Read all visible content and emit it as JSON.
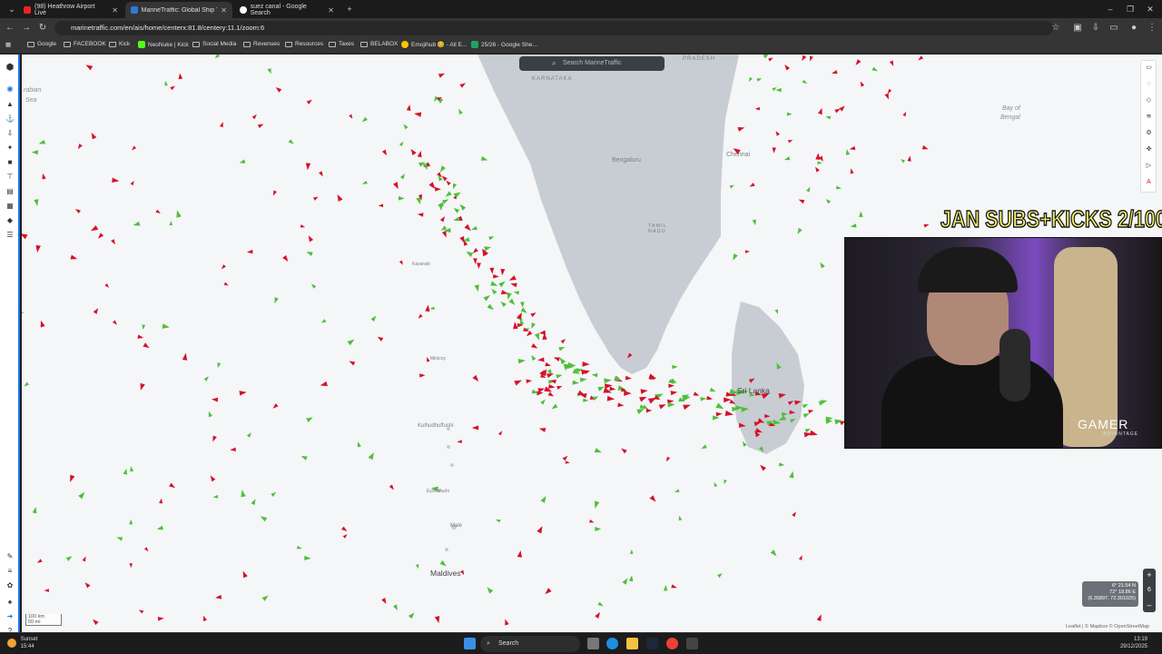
{
  "browser": {
    "tabs": [
      {
        "title": "(98) Heathrow Airport Live",
        "active": false
      },
      {
        "title": "MarineTraffic: Global Ship Track",
        "active": true
      },
      {
        "title": "suez canal - Google Search",
        "active": false
      }
    ],
    "url": "marinetraffic.com/en/ais/home/centerx:81.8/centery:11.1/zoom:6",
    "bookmarks": [
      "Google",
      "FACEBOOK",
      "Kick",
      "NeoNuke | Kick",
      "Social Media",
      "Revenues",
      "Resources",
      "Taxes",
      "BELABOX",
      "Emojihub 😊 - All E...",
      "25/26 - Google She..."
    ]
  },
  "map": {
    "search_placeholder": "Search MarineTraffic",
    "labels": {
      "arabian_sea_1": "rabian",
      "arabian_sea_2": "Sea",
      "bay_of_bengal_1": "Bay of",
      "bay_of_bengal_2": "Bengal",
      "karnataka": "KARNATAKA",
      "pradesh": "PRADESH",
      "bengaluru": "Bengaluru",
      "chennai": "Chennai",
      "tamil_nadu": "TAMIL NADU",
      "sri_lanka": "Sri Lanka",
      "maldives": "Maldives",
      "kulhudhuffushi": "Kulhudhuffushi",
      "male": "Malé",
      "kavaratti": "Kavaratti",
      "minicoy": "Minicoy",
      "eydhafushi": "Eydhafushi"
    },
    "coords": {
      "lat": "6° 21.54 N",
      "lon": "72° 18.86 E",
      "decimal": "(6.35897, 72.301025)"
    },
    "zoom_level": "6",
    "scale": {
      "km": "100 km",
      "mi": "50 mi"
    },
    "attribution": "Leaflet | © Mapbox © OpenStreetMap",
    "colors": {
      "tanker": "#d7102a",
      "cargo": "#4fbf3a",
      "land": "#c7cdd2",
      "water": "#f4f6f7"
    }
  },
  "stream": {
    "overlay_title": "JAN SUBS+KICKS 2/100",
    "brand": "GAMER",
    "brand_sub": "ADVANTAGE"
  },
  "taskbar": {
    "weather_title": "Sunset",
    "weather_time": "15:44",
    "search_label": "Search",
    "time": "13:19",
    "date": "29/12/2025"
  }
}
